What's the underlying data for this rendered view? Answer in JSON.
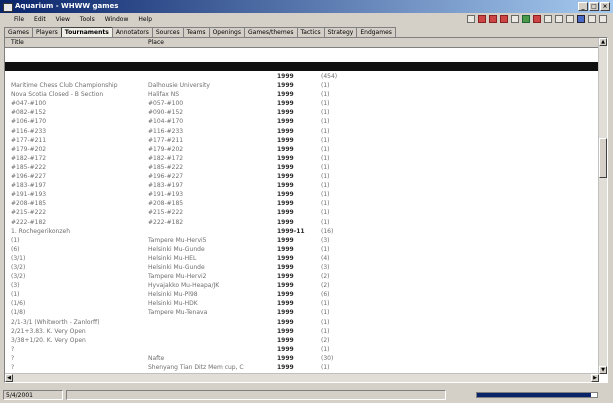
{
  "window": {
    "title": "Aquarium - WHWW games",
    "buttons": [
      "_",
      "□",
      "×"
    ]
  },
  "menu": [
    "File",
    "Edit",
    "View",
    "Tools",
    "Window",
    "Help"
  ],
  "toolbar_icons": [
    "sort-icon",
    "add-icon",
    "add-icon",
    "add-icon",
    "tools-icon",
    "refresh-icon",
    "close-icon",
    "search-icon",
    "copy-icon",
    "paste-icon",
    "database-icon",
    "chart-icon",
    "play-icon"
  ],
  "tabs": [
    {
      "label": "Games"
    },
    {
      "label": "Players"
    },
    {
      "label": "Tournaments",
      "active": true
    },
    {
      "label": "Annotators"
    },
    {
      "label": "Sources"
    },
    {
      "label": "Teams"
    },
    {
      "label": "Openings"
    },
    {
      "label": "Games/themes"
    },
    {
      "label": "Tactics"
    },
    {
      "label": "Strategy"
    },
    {
      "label": "Endgames"
    }
  ],
  "columns": {
    "title": "Title",
    "place": "Place"
  },
  "selected_row": {
    "name": "",
    "place": "",
    "year": "1999",
    "count": "(454)"
  },
  "rows": [
    {
      "name": "",
      "place": "",
      "year": "1999",
      "count": "(454)"
    },
    {
      "name": "Maritime Chess Club Championship",
      "place": "Dalhousie University",
      "year": "1999",
      "count": "(1)"
    },
    {
      "name": "Nova Scotia Closed - B Section",
      "place": "Halifax NS",
      "year": "1999",
      "count": "(1)"
    },
    {
      "name": "#047-#100",
      "place": "#057-#100",
      "year": "1999",
      "count": "(1)"
    },
    {
      "name": "#082-#152",
      "place": "#090-#152",
      "year": "1999",
      "count": "(1)"
    },
    {
      "name": "#106-#170",
      "place": "#104-#170",
      "year": "1999",
      "count": "(1)"
    },
    {
      "name": "#116-#233",
      "place": "#116-#233",
      "year": "1999",
      "count": "(1)"
    },
    {
      "name": "#177-#211",
      "place": "#177-#211",
      "year": "1999",
      "count": "(1)"
    },
    {
      "name": "#179-#202",
      "place": "#179-#202",
      "year": "1999",
      "count": "(1)"
    },
    {
      "name": "#182-#172",
      "place": "#182-#172",
      "year": "1999",
      "count": "(1)"
    },
    {
      "name": "#185-#222",
      "place": "#185-#222",
      "year": "1999",
      "count": "(1)"
    },
    {
      "name": "#196-#227",
      "place": "#196-#227",
      "year": "1999",
      "count": "(1)"
    },
    {
      "name": "#183-#197",
      "place": "#183-#197",
      "year": "1999",
      "count": "(1)"
    },
    {
      "name": "#191-#193",
      "place": "#191-#193",
      "year": "1999",
      "count": "(1)"
    },
    {
      "name": "#208-#185",
      "place": "#208-#185",
      "year": "1999",
      "count": "(1)"
    },
    {
      "name": "#215-#222",
      "place": "#215-#222",
      "year": "1999",
      "count": "(1)"
    },
    {
      "name": "#222-#182",
      "place": "#222-#182",
      "year": "1999",
      "count": "(1)"
    },
    {
      "name": "1. Rochegerikonzeh",
      "place": "",
      "year": "1999-11",
      "count": "(16)"
    },
    {
      "name": "(1)",
      "place": "Tampere Mu-Hervi5",
      "year": "1999",
      "count": "(3)"
    },
    {
      "name": "(6)",
      "place": "Helsinki Mu-Gunde",
      "year": "1999",
      "count": "(1)"
    },
    {
      "name": "(3/1)",
      "place": "Helsinki Mu-HEL",
      "year": "1999",
      "count": "(4)"
    },
    {
      "name": "(3/2)",
      "place": "Helsinki Mu-Gunde",
      "year": "1999",
      "count": "(3)"
    },
    {
      "name": "(3/2)",
      "place": "Tampere Mu-Hervi2",
      "year": "1999",
      "count": "(2)"
    },
    {
      "name": "(3)",
      "place": "Hyvajakko Mu-Heapa/JK",
      "year": "1999",
      "count": "(2)"
    },
    {
      "name": "(1)",
      "place": "Helsinki Mu-Pl98",
      "year": "1999",
      "count": "(6)"
    },
    {
      "name": "(1/6)",
      "place": "Helsinki Mu-HDK",
      "year": "1999",
      "count": "(1)"
    },
    {
      "name": "(1/8)",
      "place": "Tampere Mu-Tenava",
      "year": "1999",
      "count": "(1)"
    },
    {
      "name": "2/1-3/1 (Whitworth - Zanlorff)",
      "place": "",
      "year": "1999",
      "count": "(1)"
    },
    {
      "name": "2/21+3.83. K. Very Open",
      "place": "",
      "year": "1999",
      "count": "(1)"
    },
    {
      "name": "3/38+1/20. K. Very Open",
      "place": "",
      "year": "1999",
      "count": "(2)"
    },
    {
      "name": "?",
      "place": "",
      "year": "1999",
      "count": "(1)"
    },
    {
      "name": "?",
      "place": "Nafte",
      "year": "1999",
      "count": "(30)"
    },
    {
      "name": "?",
      "place": "Shenyang Tian Ditz Mem cup, C",
      "year": "1999",
      "count": "(1)"
    }
  ],
  "status": {
    "left": "5/4/2001",
    "progress": 0.95
  }
}
